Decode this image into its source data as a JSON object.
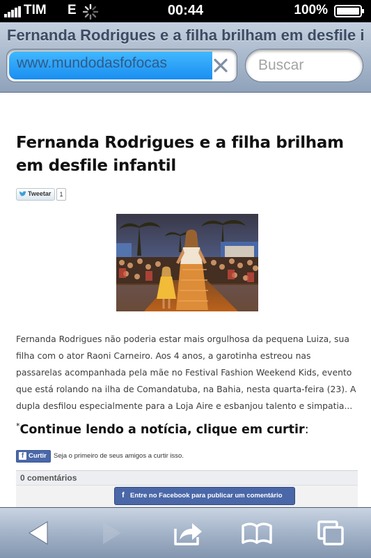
{
  "status_bar": {
    "carrier": "TIM",
    "network": "E",
    "time": "00:44",
    "battery_percent": "100%"
  },
  "browser": {
    "page_title": "Fernanda Rodrigues e a filha brilham em desfile infantil",
    "url": "www.mundodasfofocas",
    "search_placeholder": "Buscar"
  },
  "article": {
    "headline": "Fernanda Rodrigues e a filha brilham em desfile infantil",
    "tweet_label": "Tweetar",
    "tweet_count": "1",
    "body": "Fernanda Rodrigues não poderia estar mais orgulhosa da pequena Luiza, sua filha com o ator Raoni Carneiro. Aos 4 anos, a garotinha estreou nas passarelas acompanhada pela mãe no Festival Fashion Weekend Kids, evento que está rolando na ilha de Comandatuba, na Bahia, nesta quarta-feira (23). A dupla desfilou especialmente para a Loja Aire e esbanjou talento e simpatia...",
    "cta_marker": "*",
    "cta_text": "Continue lendo a notícia, clique em curtir",
    "cta_colon": ":",
    "like_label": "Curtir",
    "like_text": "Seja o primeiro de seus amigos a curtir isso.",
    "comments_count": "0 comentários",
    "fb_login_label": "Entre no Facebook para publicar um comentário"
  },
  "toolbar": {
    "icons": [
      "back-icon",
      "forward-icon",
      "share-icon",
      "bookmarks-icon",
      "tabs-icon"
    ]
  },
  "colors": {
    "facebook_blue": "#4a67a8",
    "url_highlight": "#1a8ef0",
    "chrome_blue": "#a6b6ca"
  }
}
